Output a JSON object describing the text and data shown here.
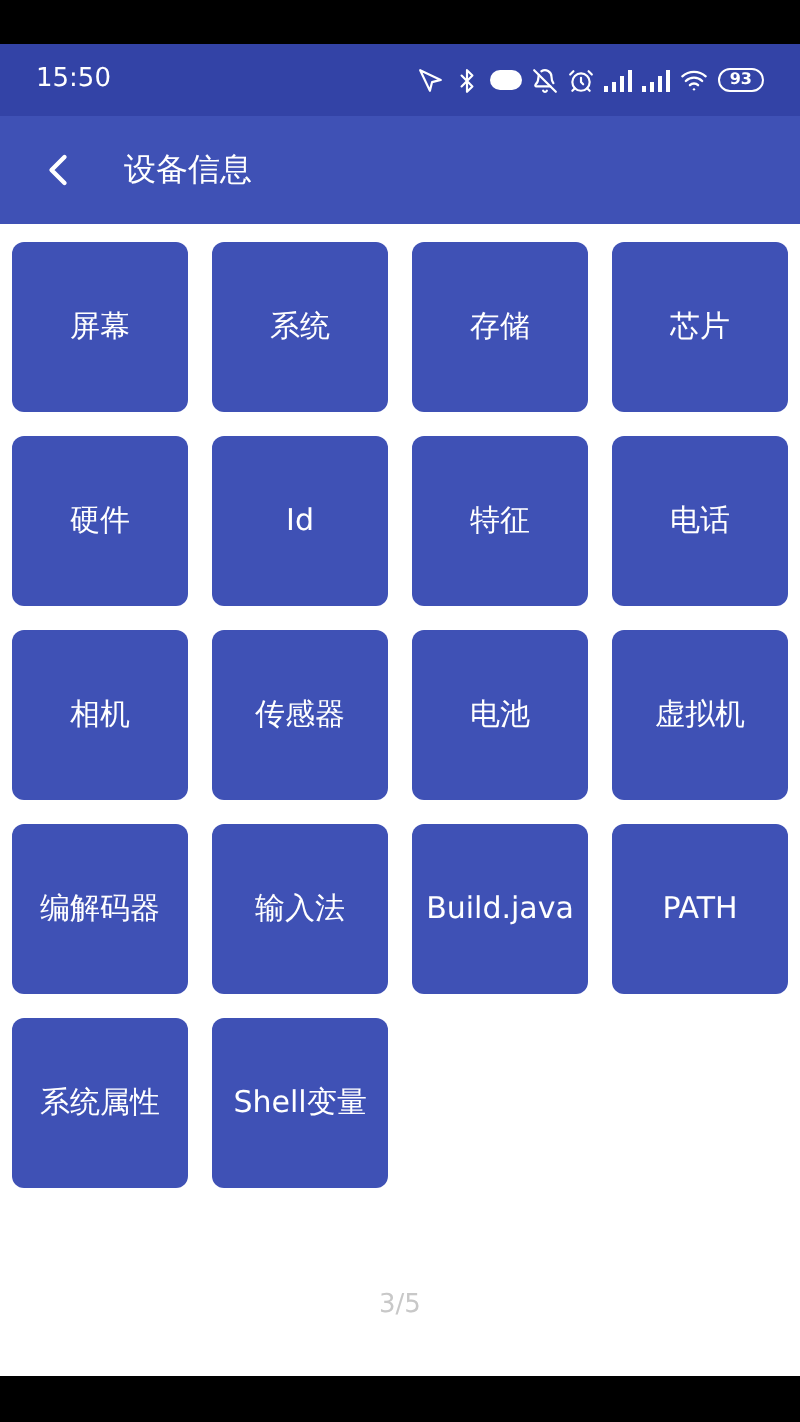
{
  "status_bar": {
    "time": "15:50",
    "battery": "93"
  },
  "app_bar": {
    "title": "设备信息"
  },
  "tiles": [
    {
      "label": "屏幕"
    },
    {
      "label": "系统"
    },
    {
      "label": "存储"
    },
    {
      "label": "芯片"
    },
    {
      "label": "硬件"
    },
    {
      "label": "Id"
    },
    {
      "label": "特征"
    },
    {
      "label": "电话"
    },
    {
      "label": "相机"
    },
    {
      "label": "传感器"
    },
    {
      "label": "电池"
    },
    {
      "label": "虚拟机"
    },
    {
      "label": "编解码器"
    },
    {
      "label": "输入法"
    },
    {
      "label": "Build.java"
    },
    {
      "label": "PATH"
    },
    {
      "label": "系统属性"
    },
    {
      "label": "Shell变量"
    }
  ],
  "page_indicator": "3/5"
}
